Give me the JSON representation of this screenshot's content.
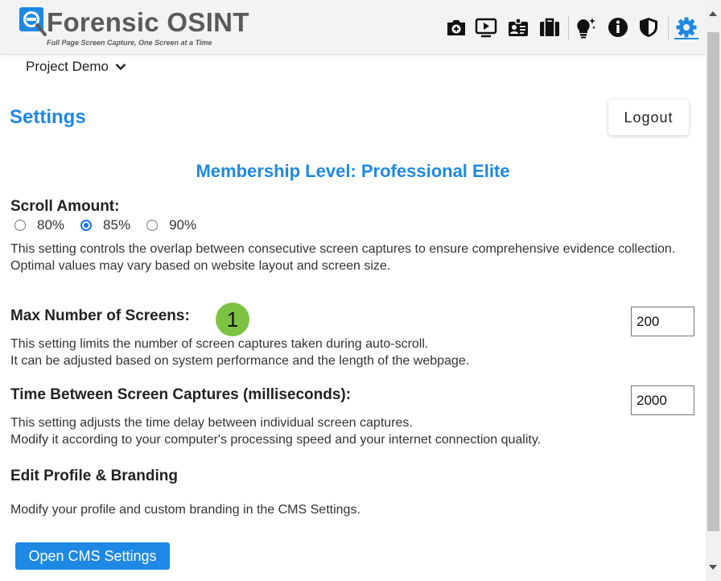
{
  "header": {
    "logo_title": "Forensic OSINT",
    "logo_subtitle": "Full Page Screen Capture, One Screen at a Time",
    "icons": [
      "camera-icon",
      "video-icon",
      "id-badge-icon",
      "briefcase-icon",
      "lightbulb-icon",
      "info-icon",
      "shield-icon",
      "gear-icon"
    ],
    "active_icon": "gear-icon"
  },
  "project": {
    "label": "Project Demo"
  },
  "settings": {
    "title": "Settings",
    "logout_label": "Logout",
    "membership": "Membership Level: Professional Elite",
    "scroll": {
      "heading": "Scroll Amount:",
      "options": [
        "80%",
        "85%",
        "90%"
      ],
      "selected": "85%",
      "desc_line1": "This setting controls the overlap between consecutive screen captures to ensure comprehensive evidence collection.",
      "desc_line2": "Optimal values may vary based on website layout and screen size."
    },
    "max_screens": {
      "heading": "Max Number of Screens:",
      "value": "200",
      "desc_line1": "This setting limits the number of screen captures taken during auto-scroll.",
      "desc_line2": "It can be adjusted based on system performance and the length of the webpage."
    },
    "annotation_badge": "1",
    "time_between": {
      "heading": "Time Between Screen Captures (milliseconds):",
      "value": "2000",
      "desc_line1": "This setting adjusts the time delay between individual screen captures.",
      "desc_line2": "Modify it according to your computer's processing speed and your internet connection quality."
    },
    "profile": {
      "heading": "Edit Profile & Branding",
      "desc": "Modify your profile and custom branding in the CMS Settings.",
      "button_label": "Open CMS Settings"
    }
  },
  "colors": {
    "accent": "#1e88e5",
    "badge": "#7cc242",
    "header_bg": "#f3f3f3",
    "logo_text": "#5a5a5a"
  }
}
